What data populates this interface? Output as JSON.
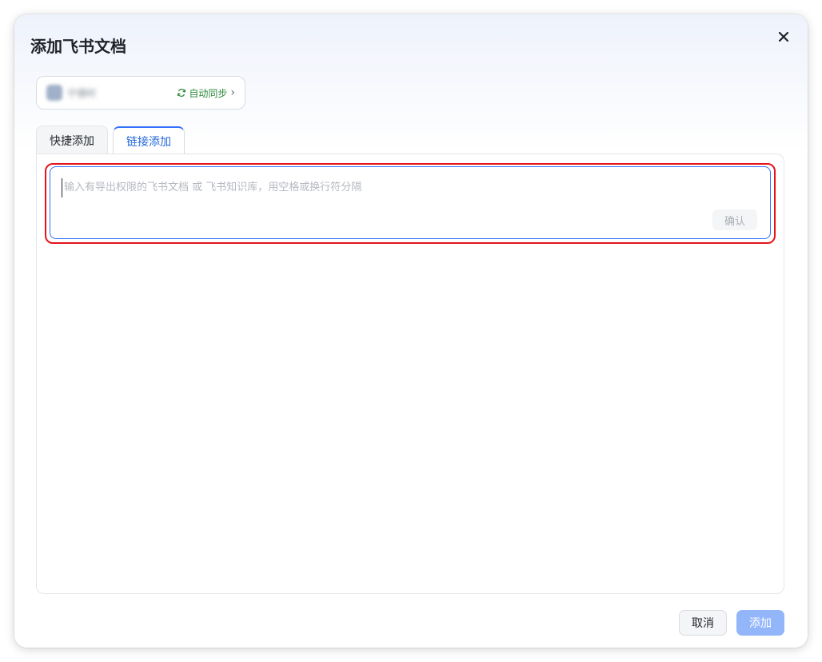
{
  "dialog": {
    "title": "添加飞书文档",
    "close_icon": "close-icon"
  },
  "source": {
    "name": "宁德时",
    "sync_label": "自动同步",
    "sync_icon": "refresh-icon",
    "chevron": "›"
  },
  "tabs": [
    {
      "label": "快捷添加",
      "active": false
    },
    {
      "label": "链接添加",
      "active": true
    }
  ],
  "link_input": {
    "value": "",
    "placeholder": "输入有导出权限的飞书文档 或 飞书知识库，用空格或换行符分隔",
    "confirm_label": "确认"
  },
  "footer": {
    "cancel_label": "取消",
    "add_label": "添加"
  },
  "colors": {
    "accent": "#3370ff",
    "sync_green": "#2f8a3b",
    "highlight_red": "#e5141b",
    "add_disabled": "#93b6fb"
  }
}
